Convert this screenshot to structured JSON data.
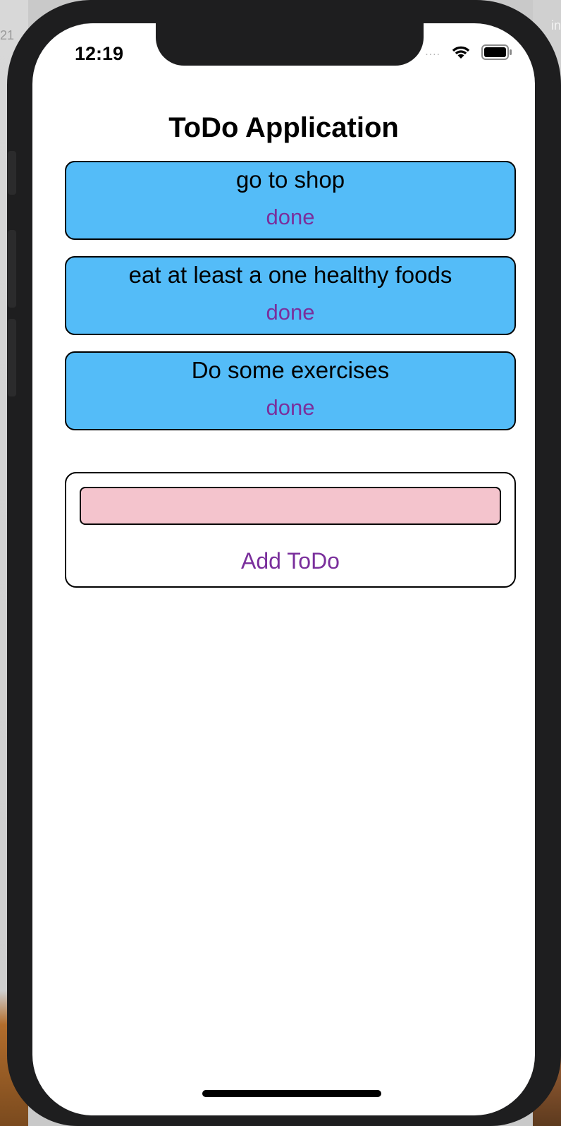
{
  "desktop": {
    "left_label": "21",
    "right_label": "in"
  },
  "status_bar": {
    "time": "12:19",
    "signal_dots": "....",
    "wifi_icon": "wifi-icon",
    "battery_icon": "battery-icon"
  },
  "app": {
    "title": "ToDo Application"
  },
  "todos": [
    {
      "text": "go to shop",
      "action": "done"
    },
    {
      "text": "eat at least a one healthy foods",
      "action": "done"
    },
    {
      "text": "Do some exercises",
      "action": "done"
    }
  ],
  "add_form": {
    "input_value": "",
    "add_button_label": "Add ToDo"
  },
  "colors": {
    "card_background": "#54bcf8",
    "action_text": "#7a2f9c",
    "input_background": "#f4c4cd"
  }
}
